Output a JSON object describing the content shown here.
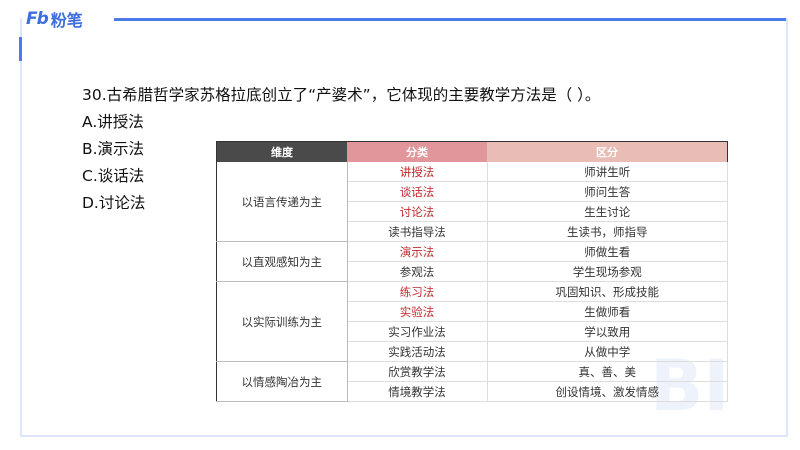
{
  "brand": {
    "logo_mark": "Fb",
    "logo_text": "粉笔"
  },
  "question": {
    "text": "30.古希腊哲学家苏格拉底创立了“产婆术”，它体现的主要教学方法是（    ）。",
    "options": [
      "A.讲授法",
      "B.演示法",
      "C.谈话法",
      "D.讨论法"
    ]
  },
  "table": {
    "headers": [
      "维度",
      "分类",
      "区分"
    ],
    "groups": [
      {
        "dimension": "以语言传递为主",
        "rows": [
          {
            "method": "讲授法",
            "desc": "师讲生听",
            "highlight": true
          },
          {
            "method": "谈话法",
            "desc": "师问生答",
            "highlight": true
          },
          {
            "method": "讨论法",
            "desc": "生生讨论",
            "highlight": true
          },
          {
            "method": "读书指导法",
            "desc": "生读书，师指导",
            "highlight": false
          }
        ]
      },
      {
        "dimension": "以直观感知为主",
        "rows": [
          {
            "method": "演示法",
            "desc": "师做生看",
            "highlight": true
          },
          {
            "method": "参观法",
            "desc": "学生现场参观",
            "highlight": false
          }
        ]
      },
      {
        "dimension": "以实际训练为主",
        "rows": [
          {
            "method": "练习法",
            "desc": "巩固知识、形成技能",
            "highlight": true
          },
          {
            "method": "实验法",
            "desc": "生做师看",
            "highlight": true
          },
          {
            "method": "实习作业法",
            "desc": "学以致用",
            "highlight": false
          },
          {
            "method": "实践活动法",
            "desc": "从做中学",
            "highlight": false
          }
        ]
      },
      {
        "dimension": "以情感陶冶为主",
        "rows": [
          {
            "method": "欣赏教学法",
            "desc": "真、善、美",
            "highlight": false
          },
          {
            "method": "情境教学法",
            "desc": "创设情境、激发情感",
            "highlight": false
          }
        ]
      }
    ]
  },
  "colors": {
    "accent": "#4a7be8",
    "highlight_text": "#c0282d"
  }
}
